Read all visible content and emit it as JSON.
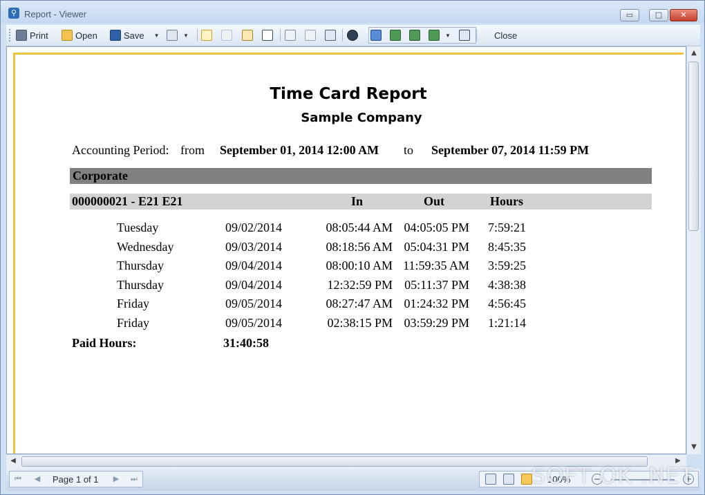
{
  "window": {
    "title": "Report - Viewer",
    "min_glyph": "▭",
    "max_glyph": "□",
    "close_glyph": "✕"
  },
  "toolbar": {
    "print": "Print",
    "open": "Open",
    "save": "Save",
    "close": "Close"
  },
  "report": {
    "title": "Time Card Report",
    "company": "Sample Company",
    "period_label": "Accounting Period:",
    "from_label": "from",
    "from_value": "September 01, 2014 12:00 AM",
    "to_label": "to",
    "to_value": "September 07, 2014 11:59 PM",
    "group": "Corporate",
    "employee": "000000021 - E21 E21",
    "columns": {
      "in": "In",
      "out": "Out",
      "hours": "Hours"
    },
    "rows": [
      {
        "day": "Tuesday",
        "date": "09/02/2014",
        "in": "08:05:44 AM",
        "out": "04:05:05 PM",
        "hours": "7:59:21"
      },
      {
        "day": "Wednesday",
        "date": "09/03/2014",
        "in": "08:18:56 AM",
        "out": "05:04:31 PM",
        "hours": "8:45:35"
      },
      {
        "day": "Thursday",
        "date": "09/04/2014",
        "in": "08:00:10 AM",
        "out": "11:59:35 AM",
        "hours": "3:59:25"
      },
      {
        "day": "Thursday",
        "date": "09/04/2014",
        "in": "12:32:59 PM",
        "out": "05:11:37 PM",
        "hours": "4:38:38"
      },
      {
        "day": "Friday",
        "date": "09/05/2014",
        "in": "08:27:47 AM",
        "out": "01:24:32 PM",
        "hours": "4:56:45"
      },
      {
        "day": "Friday",
        "date": "09/05/2014",
        "in": "02:38:15 PM",
        "out": "03:59:29 PM",
        "hours": "1:21:14"
      }
    ],
    "paid_label": "Paid Hours:",
    "paid_value": "31:40:58"
  },
  "statusbar": {
    "page": "Page 1 of 1",
    "zoom": "100%",
    "watermark": "SOFT OK .NET"
  }
}
